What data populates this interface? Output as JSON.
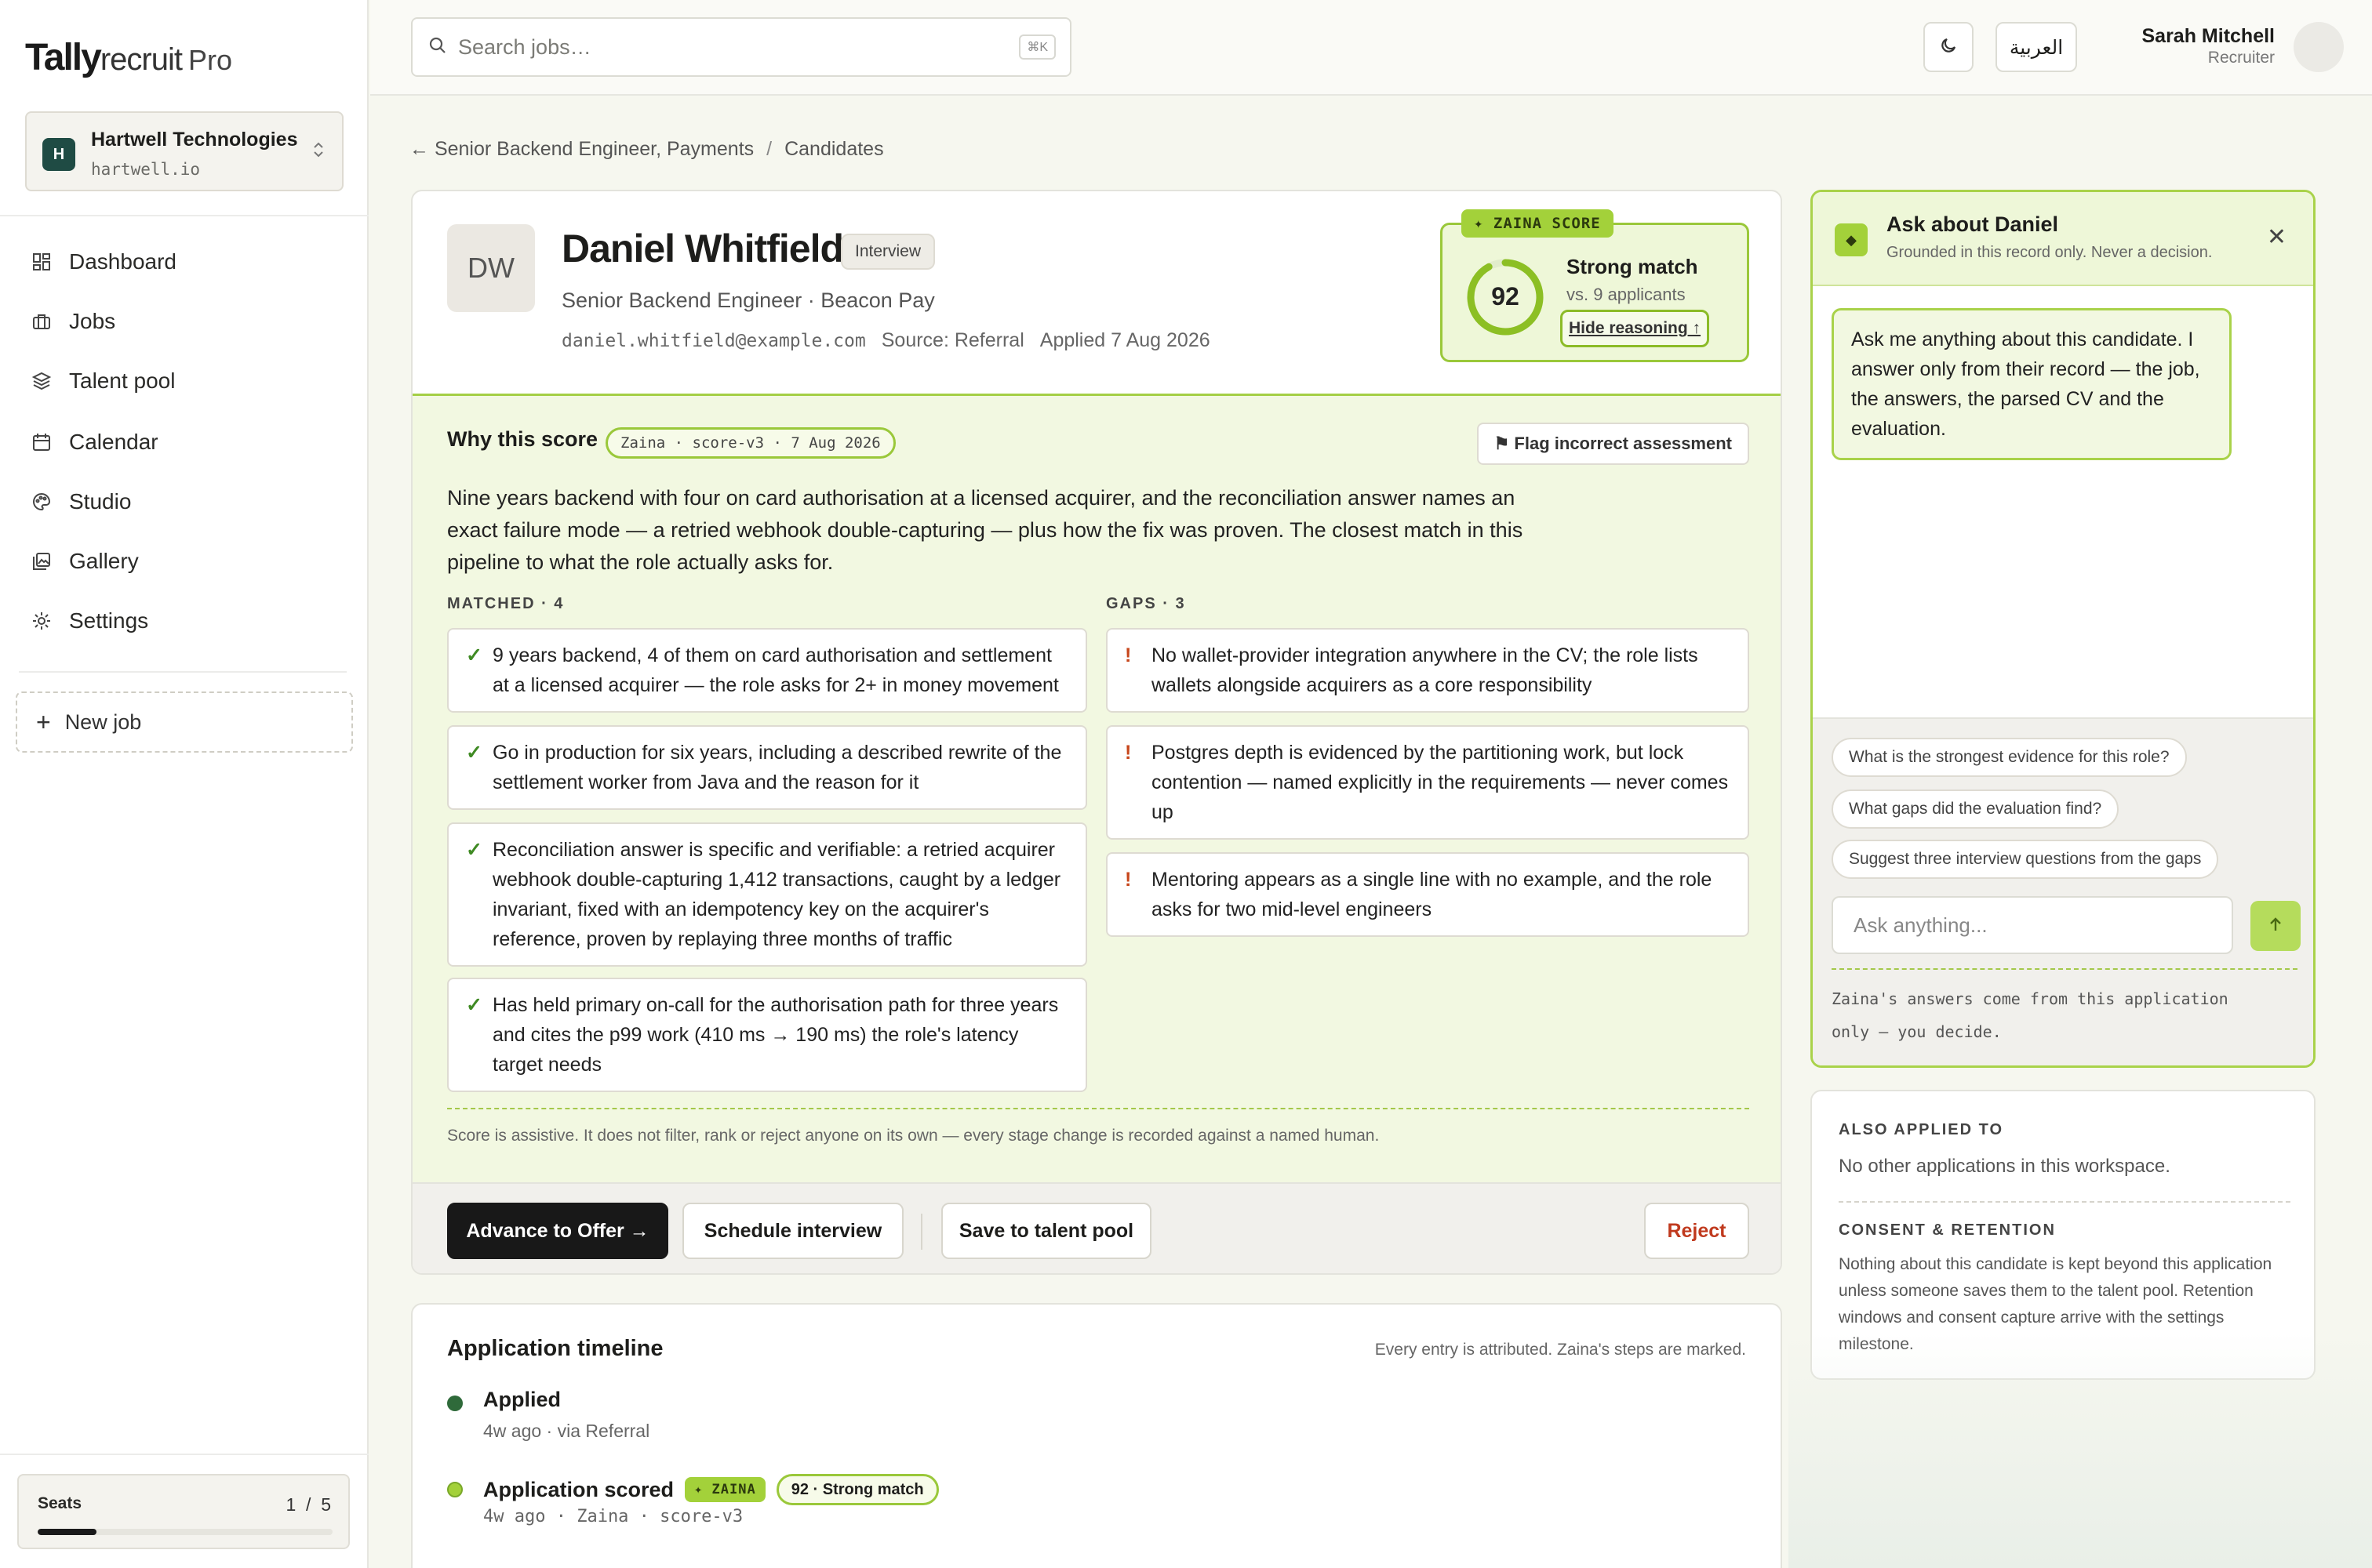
{
  "brand": {
    "name_bold": "Tally",
    "name_light": "recruit",
    "tier": "Pro"
  },
  "workspace": {
    "initial": "H",
    "name": "Hartwell Technologies",
    "domain": "hartwell.io"
  },
  "nav": [
    {
      "label": "Dashboard",
      "icon": "dashboard-icon"
    },
    {
      "label": "Jobs",
      "icon": "briefcase-icon"
    },
    {
      "label": "Talent pool",
      "icon": "layers-icon"
    },
    {
      "label": "Calendar",
      "icon": "calendar-icon"
    },
    {
      "label": "Studio",
      "icon": "palette-icon"
    },
    {
      "label": "Gallery",
      "icon": "gallery-icon"
    },
    {
      "label": "Settings",
      "icon": "gear-icon"
    }
  ],
  "new_job": {
    "label": "New job"
  },
  "seats": {
    "label": "Seats",
    "used": "1",
    "sep": "/",
    "total": "5",
    "fraction": 0.2
  },
  "topbar": {
    "search_placeholder": "Search jobs…",
    "shortcut": "⌘K",
    "language": "العربية",
    "user_name": "Sarah Mitchell",
    "user_role": "Recruiter"
  },
  "breadcrumb": {
    "back": "← Senior Backend Engineer, Payments",
    "sep": "/",
    "current": "Candidates"
  },
  "candidate": {
    "initials": "DW",
    "name": "Daniel Whitfield",
    "stage": "Interview",
    "role": "Senior Backend Engineer · Beacon Pay",
    "email": "daniel.whitfield@example.com",
    "source": "Source: Referral",
    "applied": "Applied 7 Aug 2026"
  },
  "score": {
    "tag": "✦ ZAINA SCORE",
    "value": "92",
    "percent": 92,
    "label": "Strong match",
    "compare": "vs. 9 applicants",
    "toggle": "Hide reasoning ↑"
  },
  "why": {
    "title": "Why this score",
    "version": "Zaina · score-v3 · 7 Aug 2026",
    "flag": "⚑ Flag incorrect assessment",
    "summary": "Nine years backend with four on card authorisation at a licensed acquirer, and the reconciliation answer names an exact failure mode — a retried webhook double-capturing — plus how the fix was proven. The closest match in this pipeline to what the role actually asks for.",
    "matched_header": "MATCHED · 4",
    "gaps_header": "GAPS · 3",
    "matched": [
      "9 years backend, 4 of them on card authorisation and settlement at a licensed acquirer — the role asks for 2+ in money movement",
      "Go in production for six years, including a described rewrite of the settlement worker from Java and the reason for it",
      "Reconciliation answer is specific and verifiable: a retried acquirer webhook double-capturing 1,412 transactions, caught by a ledger invariant, fixed with an idempotency key on the acquirer's reference, proven by replaying three months of traffic",
      "Has held primary on-call for the authorisation path for three years and cites the p99 work (410 ms → 190 ms) the role's latency target needs"
    ],
    "gaps": [
      "No wallet-provider integration anywhere in the CV; the role lists wallets alongside acquirers as a core responsibility",
      "Postgres depth is evidenced by the partitioning work, but lock contention — named explicitly in the requirements — never comes up",
      "Mentoring appears as a single line with no example, and the role asks for two mid-level engineers"
    ],
    "check_mark": "✓",
    "gap_mark": "!",
    "note": "Score is assistive. It does not filter, rank or reject anyone on its own — every stage change is recorded against a named human."
  },
  "actions": {
    "advance": "Advance to Offer →",
    "schedule": "Schedule interview",
    "save": "Save to talent pool",
    "reject": "Reject"
  },
  "timeline": {
    "title": "Application timeline",
    "attribution": "Every entry is attributed. Zaina's steps are marked.",
    "events": [
      {
        "title": "Applied",
        "sub": "4w ago · via Referral"
      },
      {
        "title": "Application scored",
        "tag": "✦ ZAINA",
        "score": "92 · Strong match",
        "sub": "4w ago · Zaina · score-v3"
      }
    ]
  },
  "ask": {
    "title": "Ask about Daniel",
    "subtitle": "Grounded in this record only. Never a decision.",
    "intro": "Ask me anything about this candidate. I answer only from their record — the job, the answers, the parsed CV and the evaluation.",
    "suggestions": [
      "What is the strongest evidence for this role?",
      "What gaps did the evaluation find?",
      "Suggest three interview questions from the gaps"
    ],
    "placeholder": "Ask anything...",
    "disclaimer": "Zaina's answers come from this application only — you decide."
  },
  "also": {
    "title": "ALSO APPLIED TO",
    "value": "No other applications in this workspace.",
    "consent_title": "CONSENT & RETENTION",
    "consent_text": "Nothing about this candidate is kept beyond this application unless someone saves them to the talent pool. Retention windows and consent capture arrive with the settings milestone."
  },
  "colors": {
    "accent": "#a3d13a",
    "dark_ring": "#6f9e1f",
    "green_dot": "#2f6a3a",
    "reject": "#c03a1e"
  }
}
